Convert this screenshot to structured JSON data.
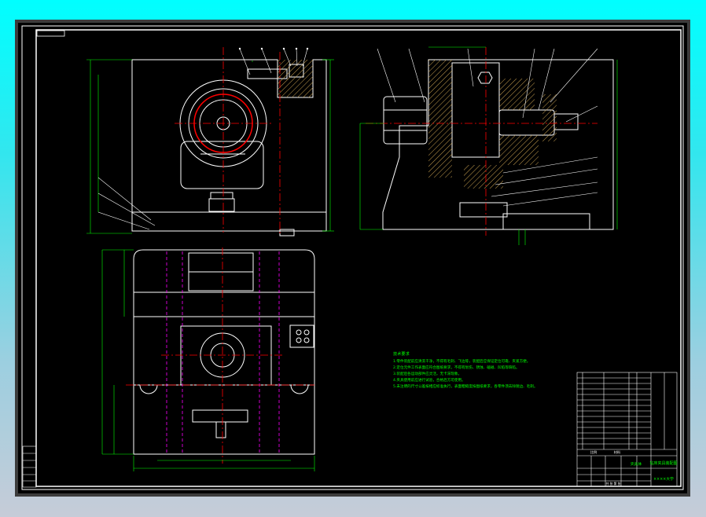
{
  "colors": {
    "frame": "#ffffff",
    "green": "#00ff00",
    "red": "#ff0000",
    "magenta": "#ff00ff",
    "part": "#ffffff",
    "hatch": "#c8a050",
    "canvas": "#000000",
    "bezel": "#3c3c3c"
  },
  "tech_notes": {
    "heading": "技术要求",
    "lines": [
      "1.零件装配前应清洗干净，不得有毛刺、飞边等，装配后应保证定位可靠、夹紧方便。",
      "2.定位元件工作表面应符合图纸要求，不得有划伤、锈蚀、磕碰、凹陷等缺陷。",
      "3.装配后各运动部件应灵活，无卡滞现象。",
      "4.夹具使用前应进行试验，合格后方可使用。",
      "5.未注明的尺寸公差按相应标准执行，表面粗糙度按图纸要求，各零件须去除锐边、毛刺。"
    ]
  },
  "title_block": {
    "drawing_title": "钻床夹具装配图",
    "product_name": "夹具体",
    "school": "××××大学",
    "scale_label": "比例",
    "material_label": "材料",
    "sheet_label": "共 张 第 张"
  }
}
